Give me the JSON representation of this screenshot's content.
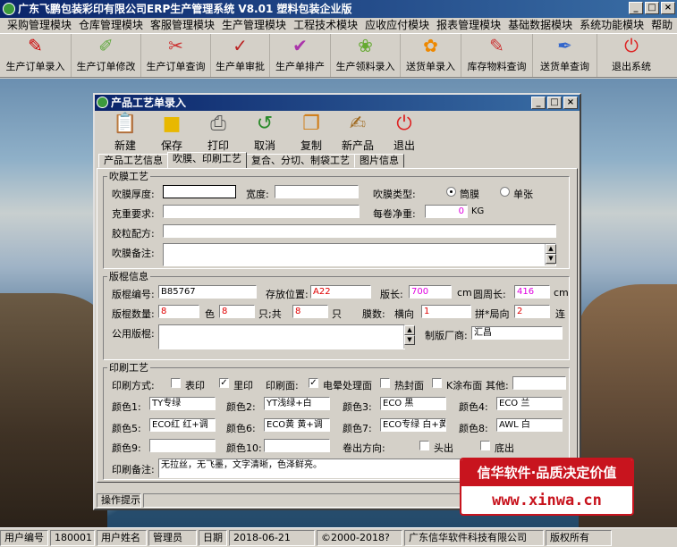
{
  "app": {
    "title": "广东飞鹏包装彩印有限公司ERP生产管理系统  V8.01  塑料包装企业版"
  },
  "window_buttons": [
    "_",
    "□",
    "×"
  ],
  "menu": [
    "采购管理模块",
    "仓库管理模块",
    "客服管理模块",
    "生产管理模块",
    "工程技术模块",
    "应收应付模块",
    "报表管理模块",
    "基础数据模块",
    "系统功能模块",
    "帮助"
  ],
  "toolbar": [
    {
      "label": "生产订单录入",
      "icon": "pdf-icon"
    },
    {
      "label": "生产订单修改",
      "icon": "edit-order-icon"
    },
    {
      "label": "生产订单查询",
      "icon": "query-order-icon"
    },
    {
      "label": "生产单审批",
      "icon": "approve-icon"
    },
    {
      "label": "生产单排产",
      "icon": "schedule-icon"
    },
    {
      "label": "生产领料录入",
      "icon": "material-icon"
    },
    {
      "label": "送货单录入",
      "icon": "delivery-icon"
    },
    {
      "label": "库存物料查询",
      "icon": "stock-icon"
    },
    {
      "label": "送货单查询",
      "icon": "delivery-query-icon"
    },
    {
      "label": "退出系统",
      "icon": "exit-icon"
    }
  ],
  "child": {
    "title": "产品工艺单录入",
    "toolbar": [
      {
        "label": "新建",
        "icon": "clipboard-icon"
      },
      {
        "label": "保存",
        "icon": "save-icon"
      },
      {
        "label": "打印",
        "icon": "printer-icon"
      },
      {
        "label": "取消",
        "icon": "undo-icon"
      },
      {
        "label": "复制",
        "icon": "copy-icon"
      },
      {
        "label": "新产品",
        "icon": "new-product-icon"
      },
      {
        "label": "退出",
        "icon": "exit-icon"
      }
    ],
    "tabs": [
      "产品工艺信息",
      "吹膜、印刷工艺",
      "复合、分切、制袋工艺",
      "图片信息"
    ],
    "active_tab": 1,
    "blown": {
      "legend": "吹膜工艺",
      "thickness_label": "吹膜厚度:",
      "thickness_value": "",
      "width_label": "宽度:",
      "width_value": "",
      "type_label": "吹膜类型:",
      "type_opt1": "筒膜",
      "type_opt2": "单张",
      "type_selected": "筒膜",
      "weight_req_label": "克重要求:",
      "weight_req_value": "",
      "net_label": "每卷净重:",
      "net_value": "0",
      "net_unit": "KG",
      "formula_label": "胶粒配方:",
      "formula_value": "",
      "remark_label": "吹膜备注:",
      "remark_value": ""
    },
    "plate": {
      "legend": "版棍信息",
      "no_label": "版棍编号:",
      "no_value": "B85767",
      "loc_label": "存放位置:",
      "loc_value": "A22",
      "len_label": "版长:",
      "len_value": "700",
      "len_unit": "cm",
      "circ_label": "圆周长:",
      "circ_value": "416",
      "circ_unit": "cm",
      "qty_label": "版棍数量:",
      "qty_value": "8",
      "color_label": "色",
      "color_value": "8",
      "pieces_label": "只;共",
      "pieces_value": "8",
      "pieces_unit": "只",
      "mold_label": "膜数:",
      "horiz_label": "横向",
      "horiz_value": "1",
      "joint_label": "拼*局向",
      "joint_value": "2",
      "joint_unit": "连",
      "public_label": "公用版棍:",
      "public_value": "",
      "maker_label": "制版厂商:",
      "maker_value": "汇昌"
    },
    "print": {
      "legend": "印刷工艺",
      "method_label": "印刷方式:",
      "surface_label": "表印",
      "surface_checked": false,
      "inner_label": "里印",
      "inner_checked": true,
      "face_label": "印刷面:",
      "corona_label": "电晕处理面",
      "corona_checked": true,
      "heat_label": "热封面",
      "heat_checked": false,
      "k_label": "K涂布面",
      "k_checked": false,
      "other_label": "其他:",
      "other_value": "",
      "colors": [
        {
          "label": "颜色1:",
          "value": "TY专绿"
        },
        {
          "label": "颜色2:",
          "value": "YT浅绿+白"
        },
        {
          "label": "颜色3:",
          "value": "ECO 黑"
        },
        {
          "label": "颜色4:",
          "value": "ECO 兰"
        },
        {
          "label": "颜色5:",
          "value": "ECO红 红+调"
        },
        {
          "label": "颜色6:",
          "value": "ECO黄 黄+调"
        },
        {
          "label": "颜色7:",
          "value": "ECO专绿 白+黄+"
        },
        {
          "label": "颜色8:",
          "value": "AWL 白"
        },
        {
          "label": "颜色9:",
          "value": ""
        },
        {
          "label": "颜色10:",
          "value": ""
        }
      ],
      "roll_label": "卷出方向:",
      "head_label": "头出",
      "head_checked": false,
      "tail_label": "底出",
      "tail_checked": false,
      "remark_label": "印刷备注:",
      "remark_value": "无拉丝，无飞墨，文字清晰，色泽鲜亮。"
    },
    "status_hint": "操作提示"
  },
  "statusbar": {
    "user_no_label": "用户编号",
    "user_no": "180001",
    "user_name_label": "用户姓名",
    "user_name": "管理员",
    "date_label": "日期",
    "date": "2018-06-21",
    "copyright": "©2000-2018?",
    "company": "广东信华软件科技有限公司",
    "rights": "版权所有"
  },
  "watermark": {
    "line1": "信华软件·品质决定价值",
    "line2": "www.xinwa.cn"
  },
  "colors": {
    "title_start": "#0a246a",
    "title_end": "#3a6ea5",
    "badge_red": "#c8141e",
    "value_red": "#e00000",
    "value_magenta": "#e000e0"
  }
}
